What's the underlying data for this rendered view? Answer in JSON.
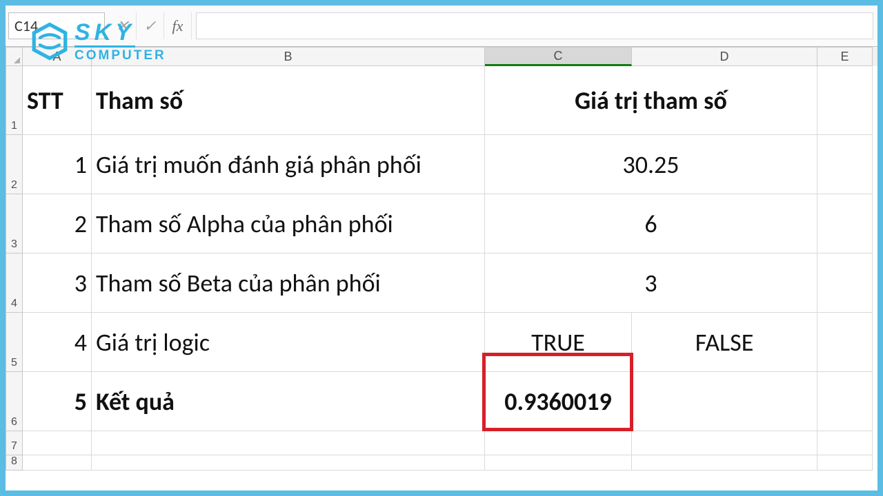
{
  "watermark": {
    "line1": "SKY",
    "line2": "COMPUTER"
  },
  "formula_bar": {
    "name_box": "C14",
    "cancel_glyph": "✕",
    "accept_glyph": "✓",
    "fx_glyph": "fx",
    "formula": ""
  },
  "columns": [
    "A",
    "B",
    "C",
    "D",
    "E"
  ],
  "row_labels": [
    "1",
    "2",
    "3",
    "4",
    "5",
    "6",
    "7",
    "8"
  ],
  "grid": {
    "header": {
      "stt": "STT",
      "param": "Tham số",
      "value": "Giá trị tham số"
    },
    "rows": [
      {
        "n": "1",
        "param": "Giá trị muốn đánh giá phân phối",
        "value": "30.25",
        "value2": ""
      },
      {
        "n": "2",
        "param": "Tham số Alpha của phân phối",
        "value": "6",
        "value2": ""
      },
      {
        "n": "3",
        "param": "Tham số Beta của phân phối",
        "value": "3",
        "value2": ""
      },
      {
        "n": "4",
        "param": "Giá trị logic",
        "value": "TRUE",
        "value2": "FALSE"
      },
      {
        "n": "5",
        "param": "Kết quả",
        "value": "0.9360019",
        "value2": ""
      }
    ]
  },
  "selected_column": "C",
  "highlight_cell": "C6"
}
